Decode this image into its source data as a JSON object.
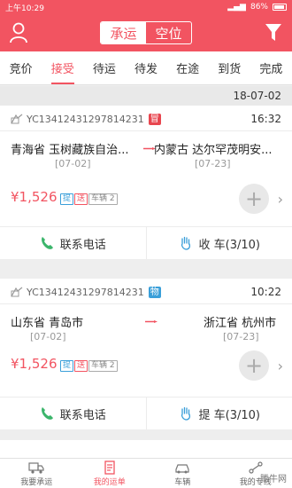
{
  "status": {
    "time": "上午10:29",
    "battery": "86%"
  },
  "header": {
    "seg_active": "承运",
    "seg_inactive": "空位"
  },
  "tabs": [
    {
      "label": "竞价"
    },
    {
      "label": "接受"
    },
    {
      "label": "待运"
    },
    {
      "label": "待发"
    },
    {
      "label": "在途"
    },
    {
      "label": "到货"
    },
    {
      "label": "完成"
    }
  ],
  "date_header": "18-07-02",
  "orders": [
    {
      "order_no": "YC13412431297814231",
      "tag": "冒",
      "tag_color": "#e8464f",
      "time": "16:32",
      "origin": "青海省 玉树藏族自治...",
      "origin_date": "[07-02]",
      "dest": "内蒙古 达尔罕茂明安...",
      "dest_date": "[07-23]",
      "price": "¥1,526",
      "pill_pick": "提",
      "pill_send": "送",
      "pill_vehicle": "车辆 2",
      "call_label": "联系电话",
      "action_label": "收 车(3/10)"
    },
    {
      "order_no": "YC13412431297814231",
      "tag": "物",
      "tag_color": "#3a9fd9",
      "time": "10:22",
      "origin": "山东省 青岛市",
      "origin_date": "[07-02]",
      "dest": "浙江省 杭州市",
      "dest_date": "[07-23]",
      "price": "¥1,526",
      "pill_pick": "提",
      "pill_send": "送",
      "pill_vehicle": "车辆 2",
      "call_label": "联系电话",
      "action_label": "提 车(3/10)"
    }
  ],
  "bottom_nav": [
    {
      "label": "我要承运"
    },
    {
      "label": "我的运单"
    },
    {
      "label": "车辆"
    },
    {
      "label": "我的专线"
    }
  ],
  "watermark": "腾牛网",
  "colors": {
    "accent": "#f25461",
    "blue": "#3a9fd9",
    "green": "#3bb56b"
  }
}
